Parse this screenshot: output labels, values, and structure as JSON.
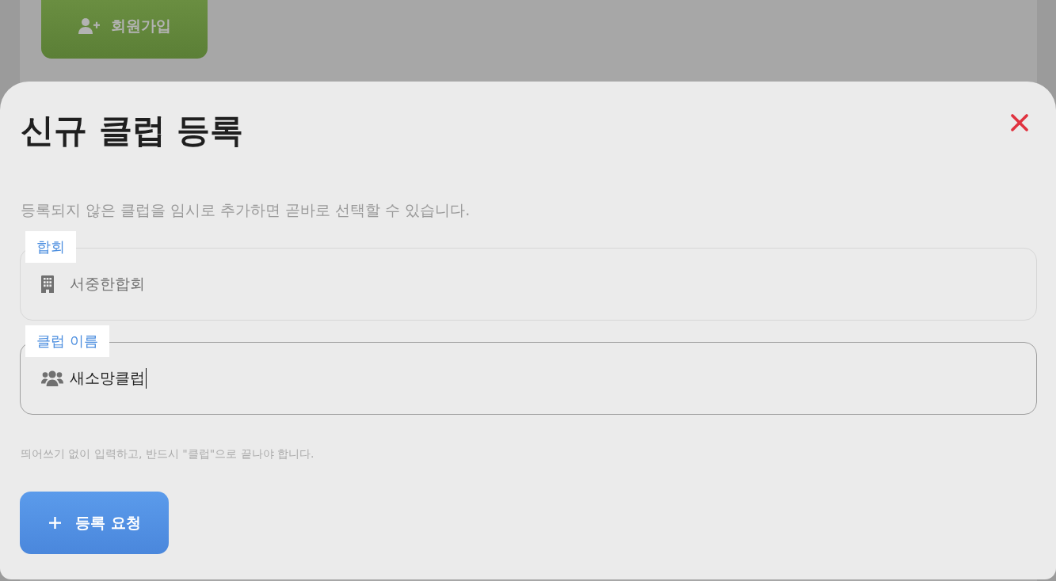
{
  "background_page": {
    "signup_button": {
      "label": "회원가입"
    }
  },
  "dialog": {
    "title": "신규 클럽 등록",
    "description": "등록되지 않은 클럽을 임시로 추가하면 곧바로 선택할 수 있습니다.",
    "fields": [
      {
        "label": "합회",
        "value": "서중한합회",
        "kind": "building",
        "disabled": true,
        "focused": false
      },
      {
        "label": "클럽 이름",
        "value": "새소망클럽",
        "kind": "group",
        "disabled": false,
        "focused": true
      }
    ],
    "hint": "띄어쓰기 없이 입력하고, 반드시 \"클럽\"으로 끝나야 합니다.",
    "submit_button": {
      "label": "등록 요청"
    }
  }
}
